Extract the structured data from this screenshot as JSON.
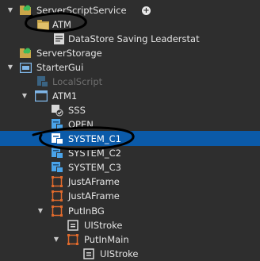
{
  "explorer": {
    "items": [
      {
        "label": "ServerScriptService",
        "icon": "cloud-folder-icon"
      },
      {
        "label": "ATM",
        "icon": "folder-icon"
      },
      {
        "label": "DataStore Saving Leaderstat",
        "icon": "script-icon"
      },
      {
        "label": "ServerStorage",
        "icon": "cloud-folder-icon"
      },
      {
        "label": "StarterGui",
        "icon": "startergui-icon"
      },
      {
        "label": "LocalScript",
        "icon": "localscript-icon"
      },
      {
        "label": "ATM1",
        "icon": "screengui-icon"
      },
      {
        "label": "SSS",
        "icon": "module-check-icon"
      },
      {
        "label": "OPEN",
        "icon": "localscript-icon"
      },
      {
        "label": "SYSTEM_C1",
        "icon": "localscript-icon"
      },
      {
        "label": "SYSTEM_C2",
        "icon": "localscript-icon"
      },
      {
        "label": "SYSTEM_C3",
        "icon": "localscript-icon"
      },
      {
        "label": "JustAFrame",
        "icon": "frame-icon"
      },
      {
        "label": "JustAFrame",
        "icon": "frame-icon"
      },
      {
        "label": "PutInBG",
        "icon": "frame-icon"
      },
      {
        "label": "UIStroke",
        "icon": "uistroke-icon"
      },
      {
        "label": "PutInMain",
        "icon": "frame-icon"
      },
      {
        "label": "UIStroke",
        "icon": "uistroke-icon"
      }
    ],
    "selected": "SYSTEM_C1",
    "plus_label": "+"
  },
  "colors": {
    "background": "#2e2e2e",
    "selection": "#0b5aa8",
    "frame_orange": "#e06a2c",
    "script_blue": "#4aa3e8",
    "annotation": "#000000"
  }
}
